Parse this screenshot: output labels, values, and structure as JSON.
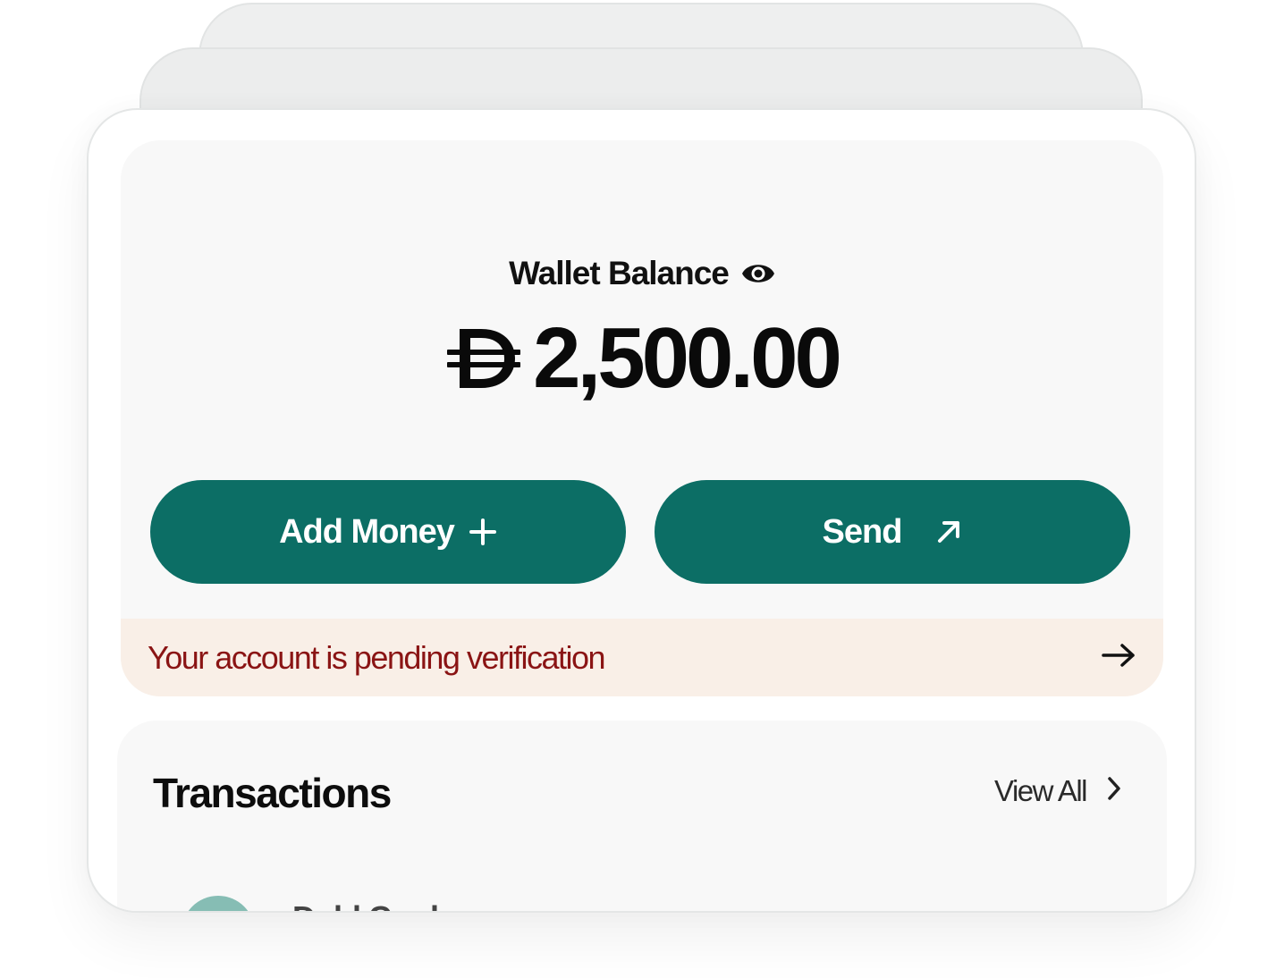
{
  "wallet": {
    "label": "Wallet Balance",
    "amount": "2,500.00",
    "currency_icon": "dirham-icon",
    "visibility_icon": "eye-icon"
  },
  "actions": {
    "add_money_label": "Add Money",
    "add_money_icon": "plus-icon",
    "send_label": "Send",
    "send_icon": "arrow-up-right-icon"
  },
  "verification": {
    "message": "Your account is pending verification",
    "icon": "arrow-right-icon"
  },
  "transactions": {
    "title": "Transactions",
    "view_all_label": "View All",
    "view_all_icon": "chevron-right-icon",
    "items": [
      {
        "name": "Dubl Card"
      }
    ]
  },
  "colors": {
    "primary": "#0c6e65",
    "warning_text": "#8a1414",
    "warning_bg": "#f9efe7",
    "avatar": "#86bdb4"
  }
}
